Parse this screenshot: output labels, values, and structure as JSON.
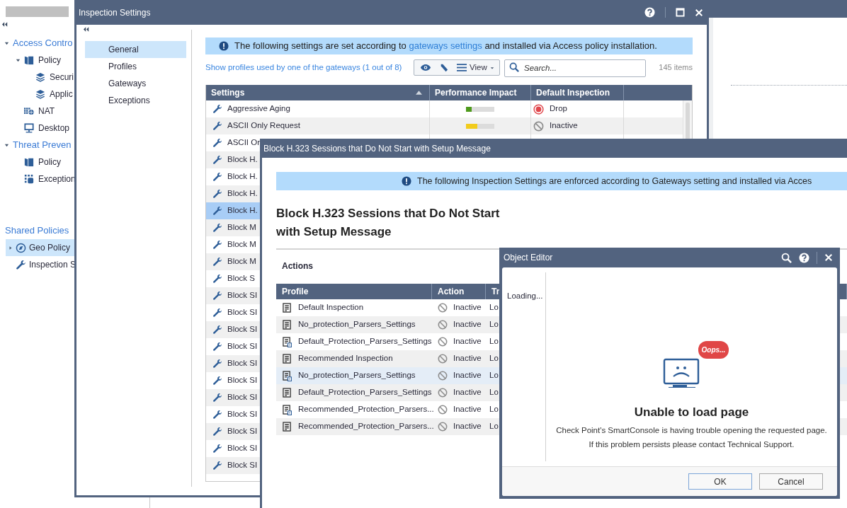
{
  "background_app": {
    "tree": [
      {
        "label": "Access Contro",
        "kind": "section",
        "expanded": true,
        "children": [
          {
            "label": "Policy",
            "kind": "policy",
            "expanded": true,
            "children": [
              {
                "label": "Securi",
                "kind": "layers"
              },
              {
                "label": "Applic",
                "kind": "layers"
              }
            ]
          },
          {
            "label": "NAT",
            "kind": "nat"
          },
          {
            "label": "Desktop",
            "kind": "desktop"
          }
        ]
      },
      {
        "label": "Threat Preven",
        "kind": "section",
        "expanded": true,
        "children": [
          {
            "label": "Policy",
            "kind": "policy"
          },
          {
            "label": "Exception",
            "kind": "exceptions"
          }
        ]
      }
    ],
    "shared_policies": {
      "title": "Shared Policies",
      "items": [
        {
          "label": "Geo Policy",
          "kind": "geo",
          "selected": true,
          "expanded": false
        },
        {
          "label": "Inspection S",
          "kind": "wrench",
          "selected": false
        }
      ]
    }
  },
  "inspection_window": {
    "title": "Inspection Settings",
    "nav": [
      {
        "label": "General",
        "selected": true
      },
      {
        "label": "Profiles",
        "selected": false
      },
      {
        "label": "Gateways",
        "selected": false
      },
      {
        "label": "Exceptions",
        "selected": false
      }
    ],
    "banner": {
      "before": "The following settings are set according to",
      "link": "gateways settings",
      "after": "and installed via Access policy installation."
    },
    "profiles_link": "Show profiles used by one of the gateways (1 out of 8)",
    "view_button": "View",
    "search": {
      "placeholder": "Search..."
    },
    "item_count": "145 items",
    "table": {
      "columns": [
        "Settings",
        "Performance Impact",
        "Default Inspection"
      ],
      "rows": [
        {
          "name": "Aggressive Aging",
          "selected": false,
          "impact": {
            "level": 0.2,
            "color": "#4e9a1c"
          },
          "inspection": {
            "kind": "drop",
            "label": "Drop"
          }
        },
        {
          "name": "ASCII Only Request",
          "selected": false,
          "impact": {
            "level": 0.4,
            "color": "#f2cc1d"
          },
          "inspection": {
            "kind": "inactive",
            "label": "Inactive"
          }
        },
        {
          "name": "ASCII On",
          "selected": false
        },
        {
          "name": "Block H.",
          "selected": false
        },
        {
          "name": "Block H.",
          "selected": false
        },
        {
          "name": "Block H.",
          "selected": false
        },
        {
          "name": "Block H.",
          "selected": true
        },
        {
          "name": "Block M",
          "selected": false
        },
        {
          "name": "Block M",
          "selected": false
        },
        {
          "name": "Block M",
          "selected": false
        },
        {
          "name": "Block S",
          "selected": false
        },
        {
          "name": "Block SI",
          "selected": false
        },
        {
          "name": "Block SI",
          "selected": false
        },
        {
          "name": "Block SI",
          "selected": false
        },
        {
          "name": "Block SI",
          "selected": false
        },
        {
          "name": "Block SI",
          "selected": false
        },
        {
          "name": "Block SI",
          "selected": false
        },
        {
          "name": "Block SI",
          "selected": false
        },
        {
          "name": "Block SI",
          "selected": false
        },
        {
          "name": "Block SI",
          "selected": false
        },
        {
          "name": "Block SI",
          "selected": false
        },
        {
          "name": "Block SI",
          "selected": false
        }
      ]
    }
  },
  "protection_window": {
    "title": "Block H.323 Sessions that Do Not Start with Setup Message",
    "banner": "The following Inspection Settings are enforced according to Gateways setting and installed via Acces",
    "heading": "Block H.323 Sessions that Do Not Start with Setup Message",
    "section": "Actions",
    "table": {
      "columns": [
        "Profile",
        "Action",
        "Tr"
      ],
      "rows": [
        {
          "profile": "Default Inspection",
          "kind": "plain",
          "action": {
            "kind": "inactive",
            "label": "Inactive"
          },
          "column_3": "Lo",
          "selected": false
        },
        {
          "profile": "No_protection_Parsers_Settings",
          "kind": "plain",
          "action": {
            "kind": "inactive",
            "label": "Inactive"
          },
          "column_3": "Lo",
          "selected": false
        },
        {
          "profile": "Default_Protection_Parsers_Settings",
          "kind": "gateway",
          "action": {
            "kind": "inactive",
            "label": "Inactive"
          },
          "column_3": "Lo",
          "selected": false
        },
        {
          "profile": "Recommended Inspection",
          "kind": "plain",
          "action": {
            "kind": "inactive",
            "label": "Inactive"
          },
          "column_3": "Lo",
          "selected": false
        },
        {
          "profile": "No_protection_Parsers_Settings",
          "kind": "gateway",
          "action": {
            "kind": "inactive",
            "label": "Inactive"
          },
          "column_3": "Lo",
          "selected": true
        },
        {
          "profile": "Default_Protection_Parsers_Settings",
          "kind": "plain",
          "action": {
            "kind": "inactive",
            "label": "Inactive"
          },
          "column_3": "Lo",
          "selected": false
        },
        {
          "profile": "Recommended_Protection_Parsers...",
          "kind": "gateway",
          "action": {
            "kind": "inactive",
            "label": "Inactive"
          },
          "column_3": "Lo",
          "selected": false
        },
        {
          "profile": "Recommended_Protection_Parsers...",
          "kind": "plain",
          "action": {
            "kind": "inactive",
            "label": "Inactive"
          },
          "column_3": "Lo",
          "selected": false
        }
      ]
    }
  },
  "object_editor": {
    "title": "Object Editor",
    "loading": "Loading...",
    "bubble": "Oops...",
    "heading": "Unable to load page",
    "message": [
      "Check Point's SmartConsole is having trouble opening the requested page.",
      "If this problem persists please contact Technical Support."
    ],
    "buttons": [
      {
        "label": "OK",
        "default": true
      },
      {
        "label": "Cancel",
        "default": false
      }
    ]
  }
}
